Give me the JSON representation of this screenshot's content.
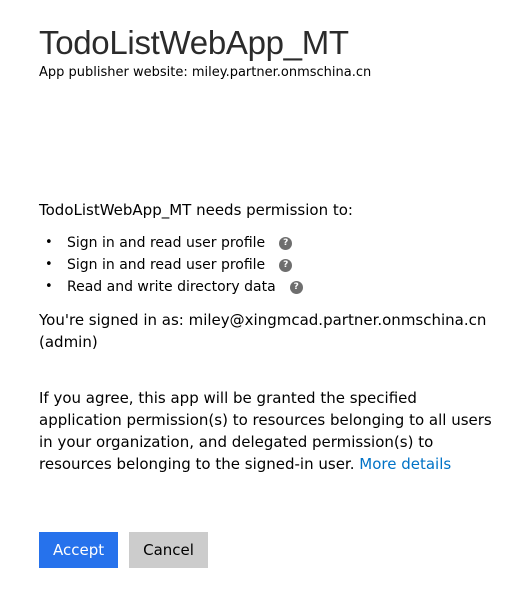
{
  "header": {
    "app_name": "TodoListWebApp_MT",
    "publisher_text": "App publisher website: miley.partner.onmschina.cn"
  },
  "permissions": {
    "intro": "TodoListWebApp_MT needs permission to:",
    "items": [
      {
        "label": "Sign in and read user profile",
        "help_icon": "question-circle-icon"
      },
      {
        "label": "Sign in and read user profile",
        "help_icon": "question-circle-icon"
      },
      {
        "label": "Read and write directory data",
        "help_icon": "question-circle-icon"
      }
    ]
  },
  "account": {
    "signed_in_text": "You're signed in as: miley@xingmcad.partner.onmschina.cn (admin)"
  },
  "consent": {
    "text": "If you agree, this app will be granted the specified application permission(s) to resources belonging to all users in your organization, and delegated permission(s) to resources belonging to the signed-in user.",
    "link_label": "More details"
  },
  "actions": {
    "accept_label": "Accept",
    "cancel_label": "Cancel"
  },
  "colors": {
    "accept_bg": "#2672ec",
    "cancel_bg": "#cccccc",
    "link": "#0072c6",
    "help_icon": "#6e6e6e"
  }
}
